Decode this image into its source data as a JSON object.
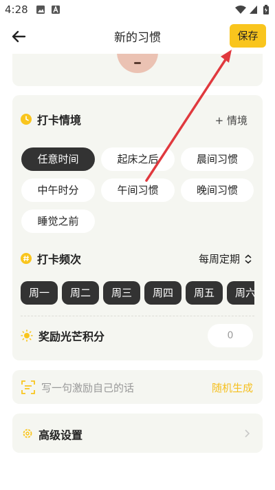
{
  "status_bar": {
    "time": "4:28"
  },
  "app_bar": {
    "title": "新的习惯",
    "save_label": "保存"
  },
  "context_section": {
    "label": "打卡情境",
    "add_label": "+ 情境",
    "chips": [
      "任意时间",
      "起床之后",
      "晨间习惯",
      "中午时分",
      "午间习惯",
      "晚间习惯",
      "睡觉之前"
    ],
    "selected": "任意时间"
  },
  "frequency_section": {
    "label": "打卡频次",
    "selected_value": "每周定期",
    "days": [
      "周一",
      "周二",
      "周三",
      "周四",
      "周五",
      "周六"
    ]
  },
  "reward_section": {
    "label": "奖励光芒积分",
    "value": "0"
  },
  "quote_card": {
    "placeholder": "写一句激励自己的话",
    "action": "随机生成"
  },
  "advanced_card": {
    "label": "高级设置"
  },
  "colors": {
    "accent": "#f9c51d",
    "dark_chip": "#333333",
    "card_bg": "#f5f6f1",
    "annotation_arrow": "#e0393e"
  }
}
